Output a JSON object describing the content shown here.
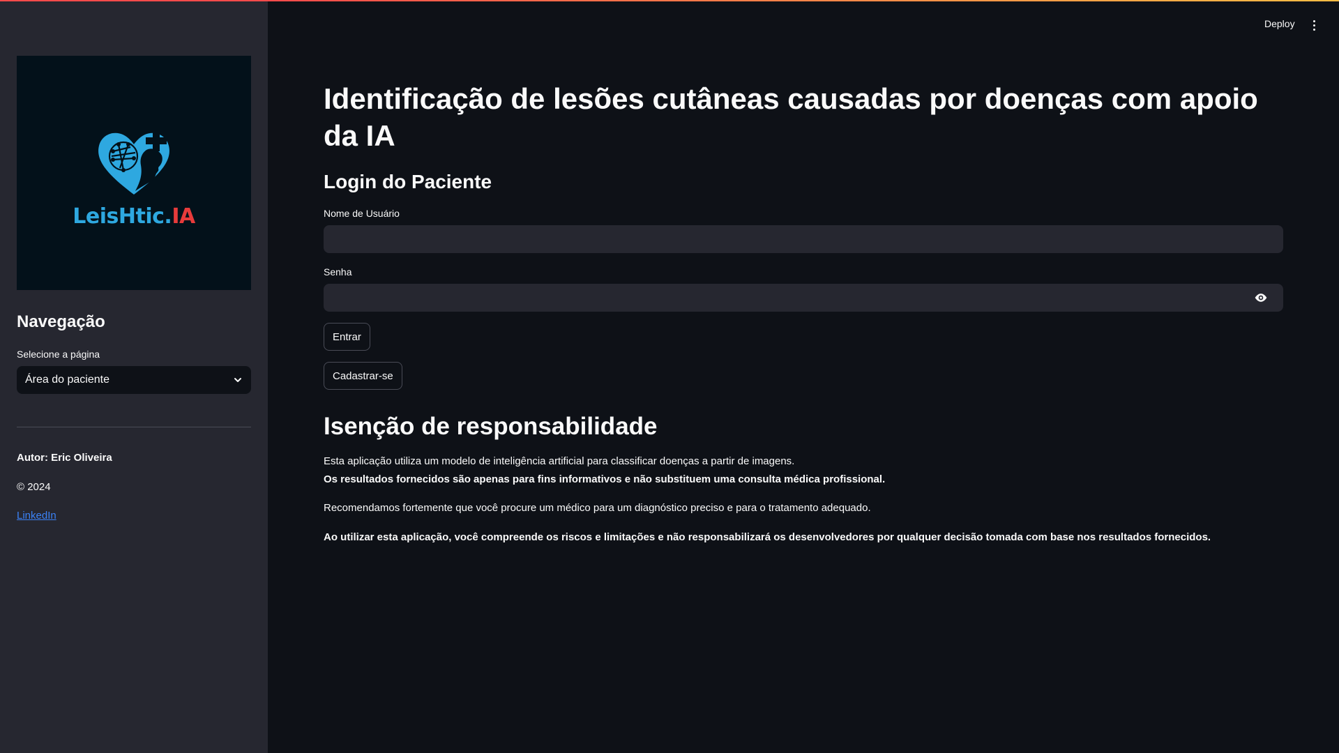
{
  "topbar": {
    "deploy_label": "Deploy",
    "menu_icon": "kebab-menu-icon"
  },
  "sidebar": {
    "logo": {
      "text_part1": "LeisHtic.",
      "text_part2": "IA",
      "colors": {
        "primary": "#2ea8e0",
        "accent": "#e83b3b",
        "background": "#03111a"
      }
    },
    "nav_title": "Navegação",
    "select_label": "Selecione a página",
    "select_value": "Área do paciente",
    "author": "Autor: Eric Oliveira",
    "copyright": "© 2024",
    "link_label": "LinkedIn"
  },
  "main": {
    "title": "Identificação de lesões cutâneas causadas por doenças com apoio da IA",
    "login_title": "Login do Paciente",
    "username_label": "Nome de Usuário",
    "username_value": "",
    "password_label": "Senha",
    "password_value": "",
    "login_button": "Entrar",
    "register_button": "Cadastrar-se",
    "disclaimer_title": "Isenção de responsabilidade",
    "para1": "Esta aplicação utiliza um modelo de inteligência artificial para classificar doenças a partir de imagens.",
    "para2": "Os resultados fornecidos são apenas para fins informativos e não substituem uma consulta médica profissional.",
    "para3": "Recomendamos fortemente que você procure um médico para um diagnóstico preciso e para o tratamento adequado.",
    "para4": "Ao utilizar esta aplicação, você compreende os riscos e limitações e não responsabilizará os desenvolvedores por qualquer decisão tomada com base nos resultados fornecidos."
  },
  "colors": {
    "app_background": "#0e1117",
    "sidebar_background": "#262730",
    "input_background": "#262730",
    "link": "#3b82f6"
  }
}
